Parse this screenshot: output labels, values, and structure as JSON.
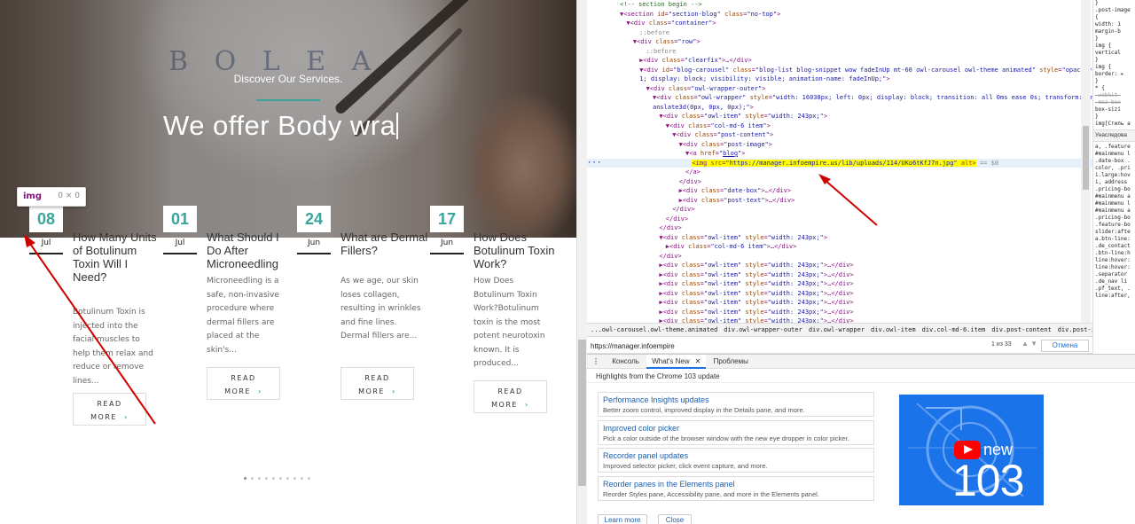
{
  "site": {
    "hero": {
      "logo": "B O L E A",
      "subtitle": "Discover Our Services.",
      "title": "We offer Body wra",
      "accent_color": "#3aa59c"
    },
    "tooltip": {
      "tag": "img",
      "size": "0 × 0"
    },
    "posts": [
      {
        "day": "08",
        "month": "Jul",
        "title": "How Many Units of Botulinum Toxin Will I Need?",
        "excerpt": "Botulinum Toxin is injected into the facial muscles to help them relax and reduce or remove lines...",
        "read": "READ",
        "more": "MORE"
      },
      {
        "day": "01",
        "month": "Jul",
        "title": "What Should I Do After Microneedling",
        "excerpt": "Microneedling is a safe, non-invasive procedure where dermal fillers are placed at the skin's...",
        "read": "READ",
        "more": "MORE"
      },
      {
        "day": "24",
        "month": "Jun",
        "title": "What are Dermal Fillers?",
        "excerpt": "As we age, our skin loses collagen, resulting in wrinkles and fine lines. Dermal fillers are...",
        "read": "READ",
        "more": "MORE"
      },
      {
        "day": "17",
        "month": "Jun",
        "title": "How Does Botulinum Toxin Work?",
        "excerpt": "How Does Botulinum Toxin Work?Botulinum toxin is the most potent neurotoxin known. It is produced...",
        "read": "READ",
        "more": "MORE"
      }
    ],
    "carousel_dots": 10,
    "active_dot": 0
  },
  "devtools": {
    "elements_rows": [
      {
        "indent": 5,
        "html": "<span class='cm'>&lt;!-- section begin --&gt;</span>"
      },
      {
        "indent": 5,
        "html": "▼&lt;<span class='t'>section</span> <span class='an'>id</span>=<span class='av'>\"section-blog\"</span> <span class='an'>class</span>=<span class='av'>\"no-top\"</span>&gt;"
      },
      {
        "indent": 6,
        "html": "▼&lt;<span class='t'>div</span> <span class='an'>class</span>=<span class='av'>\"container\"</span>&gt;"
      },
      {
        "indent": 8,
        "html": "<span class='gr'>::before</span>"
      },
      {
        "indent": 7,
        "html": "▼&lt;<span class='t'>div</span> <span class='an'>class</span>=<span class='av'>\"row\"</span>&gt;"
      },
      {
        "indent": 9,
        "html": "<span class='gr'>::before</span>"
      },
      {
        "indent": 8,
        "html": "▶&lt;<span class='t'>div</span> <span class='an'>class</span>=<span class='av'>\"clearfix\"</span>&gt;…&lt;/<span class='t'>div</span>&gt;"
      },
      {
        "indent": 8,
        "html": "▼&lt;<span class='t'>div</span> <span class='an'>id</span>=<span class='av'>\"blog-carousel\"</span> <span class='an'>class</span>=<span class='av'>\"blog-list blog-snippet wow fadeInUp mt-60 owl-carousel owl-theme animated\"</span> <span class='an'>style</span>=<span class='av'>\"opacity: 1</span>"
      },
      {
        "indent": 8,
        "html": "<span class='av'>1; display: block; visibility: visible; animation-name: fadeInUp;\"</span>&gt;"
      },
      {
        "indent": 9,
        "html": "▼&lt;<span class='t'>div</span> <span class='an'>class</span>=<span class='av'>\"owl-wrapper-outer\"</span>&gt;"
      },
      {
        "indent": 10,
        "html": "▼&lt;<span class='t'>div</span> <span class='an'>class</span>=<span class='av'>\"owl-wrapper\"</span> <span class='an'>style</span>=<span class='av'>\"width: 16038px; left: 0px; display: block; transition: all 0ms ease 0s; transform: tr</span>"
      },
      {
        "indent": 10,
        "html": "<span class='av'>anslate3d(0px, 0px, 0px);\"</span>&gt;"
      },
      {
        "indent": 11,
        "html": "▼&lt;<span class='t'>div</span> <span class='an'>class</span>=<span class='av'>\"owl-item\"</span> <span class='an'>style</span>=<span class='av'>\"width: 243px;\"</span>&gt;"
      },
      {
        "indent": 12,
        "html": "▼&lt;<span class='t'>div</span> <span class='an'>class</span>=<span class='av'>\"col-md-6 item\"</span>&gt;"
      },
      {
        "indent": 13,
        "html": "▼&lt;<span class='t'>div</span> <span class='an'>class</span>=<span class='av'>\"post-content\"</span>&gt;"
      },
      {
        "indent": 14,
        "html": "▼&lt;<span class='t'>div</span> <span class='an'>class</span>=<span class='av'>\"post-image\"</span>&gt;"
      },
      {
        "indent": 15,
        "html": "▼&lt;<span class='t'>a</span> <span class='an'>href</span>=<span class='av'>\"<u>blog</u>\"</span>&gt;"
      },
      {
        "indent": 16,
        "sel": true,
        "html": "<span class='hl'>&lt;<span class='t'>img</span> <span class='an'>src</span>=<span class='av'>\"https://manager.infoempire.us/lib/uploads/114/UKo6tKfJ7n.jpg\"</span> <span class='an'>alt</span>&gt;</span> <span class='gr'>== $0</span>"
      },
      {
        "indent": 15,
        "html": "&lt;/<span class='t'>a</span>&gt;"
      },
      {
        "indent": 14,
        "html": "&lt;/<span class='t'>div</span>&gt;"
      },
      {
        "indent": 14,
        "html": "▶&lt;<span class='t'>div</span> <span class='an'>class</span>=<span class='av'>\"date-box\"</span>&gt;…&lt;/<span class='t'>div</span>&gt;"
      },
      {
        "indent": 14,
        "html": "▶&lt;<span class='t'>div</span> <span class='an'>class</span>=<span class='av'>\"post-text\"</span>&gt;…&lt;/<span class='t'>div</span>&gt;"
      },
      {
        "indent": 13,
        "html": "&lt;/<span class='t'>div</span>&gt;"
      },
      {
        "indent": 12,
        "html": "&lt;/<span class='t'>div</span>&gt;"
      },
      {
        "indent": 11,
        "html": "&lt;/<span class='t'>div</span>&gt;"
      },
      {
        "indent": 11,
        "html": "▼&lt;<span class='t'>div</span> <span class='an'>class</span>=<span class='av'>\"owl-item\"</span> <span class='an'>style</span>=<span class='av'>\"width: 243px;\"</span>&gt;"
      },
      {
        "indent": 12,
        "html": "▶&lt;<span class='t'>div</span> <span class='an'>class</span>=<span class='av'>\"col-md-6 item\"</span>&gt;…&lt;/<span class='t'>div</span>&gt;"
      },
      {
        "indent": 11,
        "html": "&lt;/<span class='t'>div</span>&gt;"
      },
      {
        "indent": 11,
        "html": "▶&lt;<span class='t'>div</span> <span class='an'>class</span>=<span class='av'>\"owl-item\"</span> <span class='an'>style</span>=<span class='av'>\"width: 243px;\"</span>&gt;…&lt;/<span class='t'>div</span>&gt;"
      },
      {
        "indent": 11,
        "html": "▶&lt;<span class='t'>div</span> <span class='an'>class</span>=<span class='av'>\"owl-item\"</span> <span class='an'>style</span>=<span class='av'>\"width: 243px;\"</span>&gt;…&lt;/<span class='t'>div</span>&gt;"
      },
      {
        "indent": 11,
        "html": "▶&lt;<span class='t'>div</span> <span class='an'>class</span>=<span class='av'>\"owl-item\"</span> <span class='an'>style</span>=<span class='av'>\"width: 243px;\"</span>&gt;…&lt;/<span class='t'>div</span>&gt;"
      },
      {
        "indent": 11,
        "html": "▶&lt;<span class='t'>div</span> <span class='an'>class</span>=<span class='av'>\"owl-item\"</span> <span class='an'>style</span>=<span class='av'>\"width: 243px;\"</span>&gt;…&lt;/<span class='t'>div</span>&gt;"
      },
      {
        "indent": 11,
        "html": "▶&lt;<span class='t'>div</span> <span class='an'>class</span>=<span class='av'>\"owl-item\"</span> <span class='an'>style</span>=<span class='av'>\"width: 243px;\"</span>&gt;…&lt;/<span class='t'>div</span>&gt;"
      },
      {
        "indent": 11,
        "html": "▶&lt;<span class='t'>div</span> <span class='an'>class</span>=<span class='av'>\"owl-item\"</span> <span class='an'>style</span>=<span class='av'>\"width: 243px;\"</span>&gt;…&lt;/<span class='t'>div</span>&gt;"
      },
      {
        "indent": 11,
        "html": "▶&lt;<span class='t'>div</span> <span class='an'>class</span>=<span class='av'>\"owl-item\"</span> <span class='an'>style</span>=<span class='av'>\"width: 243px;\"</span>&gt;…&lt;/<span class='t'>div</span>&gt;"
      }
    ],
    "breadcrumb": [
      "...owl-carousel.owl-theme.animated",
      "div.owl-wrapper-outer",
      "div.owl-wrapper",
      "div.owl-item",
      "div.col-md-6.item",
      "div.post-content",
      "div.post-image",
      "a",
      "img"
    ],
    "search": {
      "value": "https://manager.infoempire",
      "count": "1 из 33",
      "cancel": "Отмена"
    },
    "drawer": {
      "menu": "⋮",
      "tabs": [
        "Консоль",
        "What's New",
        "Проблемы"
      ],
      "active_tab": "What's New",
      "highlights": "Highlights from the Chrome 103 update",
      "cards": [
        {
          "title": "Performance Insights updates",
          "desc": "Better zoom control, improved display in the Details pane, and more."
        },
        {
          "title": "Improved color picker",
          "desc": "Pick a color outside of the browser window with the new eye dropper in color picker."
        },
        {
          "title": "Recorder panel updates",
          "desc": "Improved selector picker, click event capture, and more."
        },
        {
          "title": "Reorder panes in the Elements panel",
          "desc": "Reorder Styles pane, Accessibility pane, and more in the Elements panel."
        }
      ],
      "promo_new": "new",
      "promo_num": "103",
      "learn_more": "Learn more",
      "close": "Close"
    },
    "styles_lines": [
      "}",
      ".post-image",
      "{",
      "  width: 1",
      "  margin-b",
      "}",
      "img {",
      "  vertical",
      "}",
      "img {",
      "  border: ▸",
      "}",
      "* {",
      "  -webkit-",
      "  -moz-box",
      "  box-sizi",
      "}",
      "img[Стиль а",
      "Унаследова",
      "a, .feature",
      "#mainmenu l",
      ".date-box .",
      "color, .pri",
      "i.large:hov",
      "i, address",
      ".pricing-bo",
      "#mainmenu a",
      "#mainmenu l",
      "#mainmenu a",
      ".pricing-bo",
      ".feature-bo",
      "slider:afte",
      "a.btn-line:",
      ".de_contact",
      ".btn-line:h",
      "line:hover:",
      "line:hover:",
      ".separator ",
      ".de_nav li ",
      ".pf_text, .",
      "line:after,"
    ]
  }
}
